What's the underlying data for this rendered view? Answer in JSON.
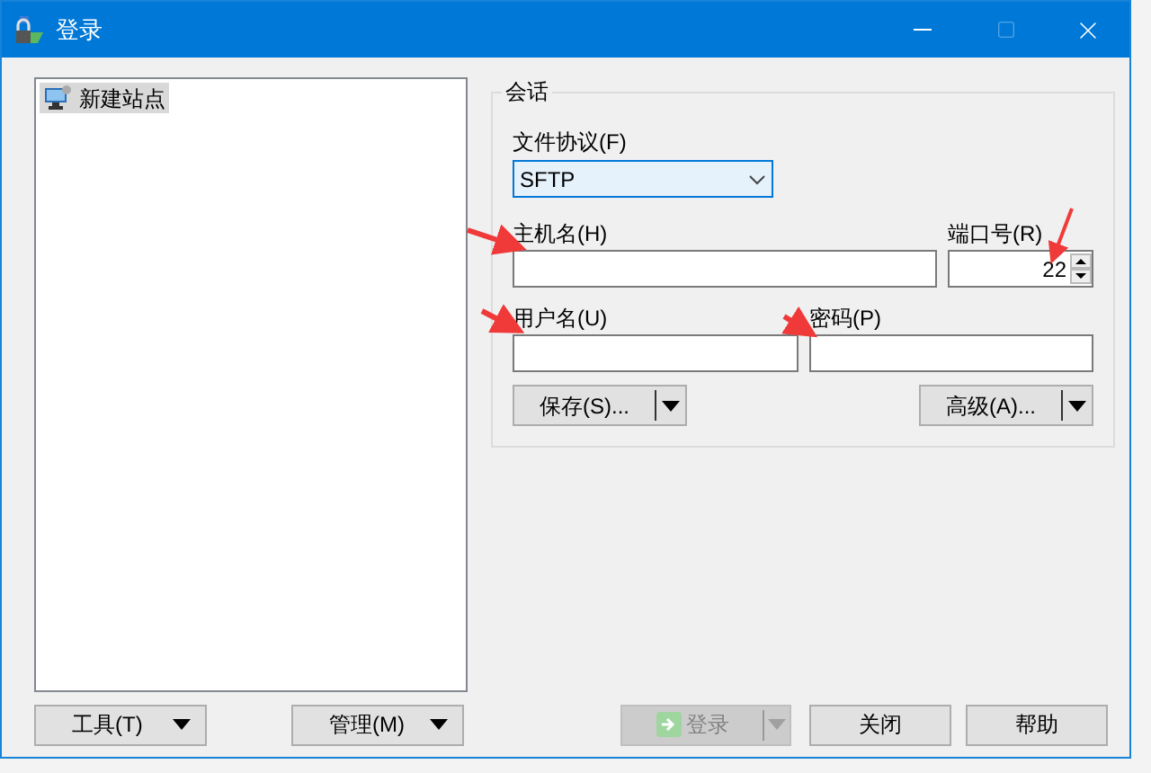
{
  "window": {
    "title": "登录"
  },
  "sites": [
    {
      "label": "新建站点",
      "selected": true
    }
  ],
  "session": {
    "title": "会话",
    "protocol": {
      "label": "文件协议(F)",
      "value": "SFTP"
    },
    "host": {
      "label": "主机名(H)"
    },
    "port": {
      "label": "端口号(R)",
      "value": "22"
    },
    "user": {
      "label": "用户名(U)"
    },
    "password": {
      "label": "密码(P)"
    },
    "save_button": "保存(S)...",
    "advanced_button": "高级(A)..."
  },
  "footer": {
    "tools": "工具(T)",
    "manage": "管理(M)",
    "login": {
      "label": "登录",
      "disabled": true
    },
    "close": "关闭",
    "help": "帮助"
  }
}
